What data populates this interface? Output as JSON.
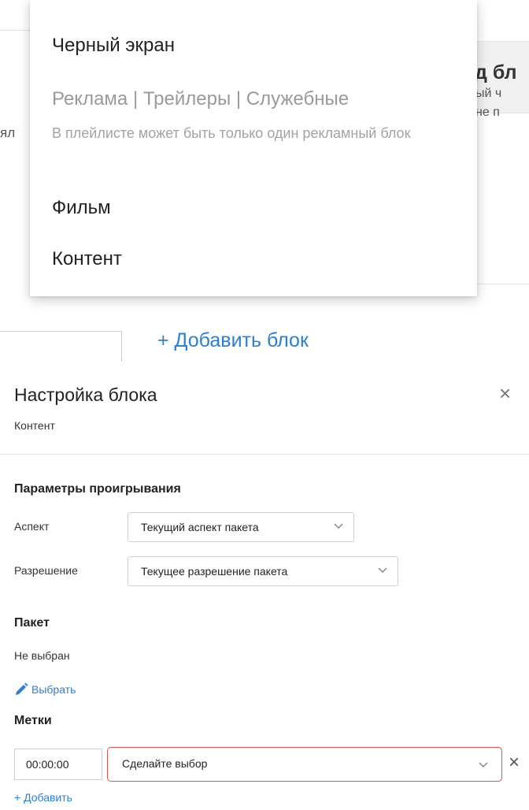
{
  "background": {
    "heading_fragment": "д бл",
    "line1_fragment": "ый ч",
    "line2_fragment": "не п",
    "left_fragment": "ял",
    "add_block_link": "+ Добавить блок"
  },
  "dropdown": {
    "items": [
      {
        "label": "Черный экран",
        "disabled": false
      },
      {
        "label": "Реклама | Трейлеры | Служебные",
        "disabled": true,
        "hint": "В плейлисте может быть только один рекламный блок"
      },
      {
        "label": "Фильм",
        "disabled": false
      },
      {
        "label": "Контент",
        "disabled": false
      }
    ]
  },
  "panel": {
    "title": "Настройка блока",
    "subtitle": "Контент",
    "close_icon": "×",
    "playback": {
      "heading": "Параметры проигрывания",
      "aspect_label": "Аспект",
      "aspect_value": "Текущий аспект пакета",
      "resolution_label": "Разрешение",
      "resolution_value": "Текущее разрешение пакета"
    },
    "package": {
      "heading": "Пакет",
      "status": "Не выбран",
      "choose_link": "Выбрать"
    },
    "tags": {
      "heading": "Метки",
      "time_value": "00:00:00",
      "select_placeholder": "Сделайте выбор",
      "remove_icon": "×",
      "add_link": "+ Добавить"
    }
  },
  "colors": {
    "link": "#2a7fd6",
    "error_border": "#d9534f",
    "disabled_text": "#9a9a9a"
  }
}
